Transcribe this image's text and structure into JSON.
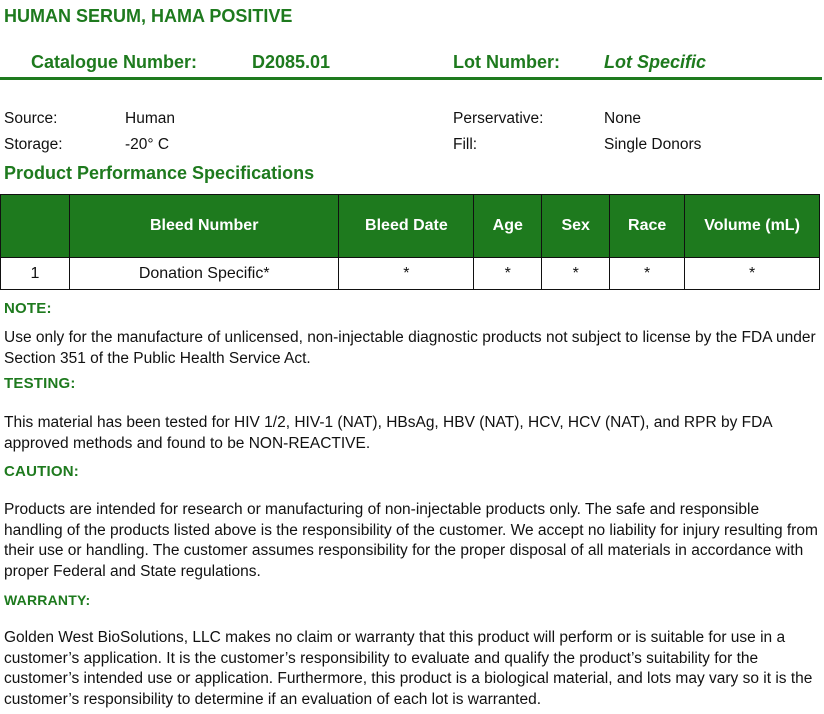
{
  "title": "HUMAN SERUM, HAMA POSITIVE",
  "catalogue": {
    "label": "Catalogue Number:",
    "value": "D2085.01",
    "lot_label": "Lot Number:",
    "lot_value": "Lot Specific"
  },
  "info": {
    "source_label": "Source:",
    "source_value": "Human",
    "storage_label": "Storage:",
    "storage_value": "-20° C",
    "preservative_label": "Perservative:",
    "preservative_value": "None",
    "fill_label": "Fill:",
    "fill_value": "Single Donors"
  },
  "specs": {
    "title": "Product Performance Specifications",
    "columns": [
      "",
      "Bleed Number",
      "Bleed Date",
      "Age",
      "Sex",
      "Race",
      "Volume (mL)"
    ],
    "rows": [
      [
        "1",
        "Donation Specific*",
        "*",
        "*",
        "*",
        "*",
        "*"
      ]
    ]
  },
  "note": {
    "heading": "NOTE:",
    "text": "Use only for the manufacture of unlicensed, non-injectable diagnostic products not subject to license by the FDA under Section 351 of the Public Health Service Act."
  },
  "testing": {
    "heading": "TESTING:",
    "text": "This material has been tested for HIV 1/2, HIV-1 (NAT), HBsAg, HBV (NAT), HCV, HCV (NAT), and RPR by FDA approved methods and found to be NON-REACTIVE."
  },
  "caution": {
    "heading": "CAUTION:",
    "text": "Products are intended for research or manufacturing of non-injectable products only. The safe and responsible handling of the products listed above is the responsibility of the customer. We accept no liability for injury resulting from their use or handling. The customer assumes responsibility for the proper disposal of all materials in accordance with proper Federal and State regulations."
  },
  "warranty": {
    "heading": "WARRANTY:",
    "text": "Golden West BioSolutions, LLC makes no claim or warranty that this product will perform or is suitable for use in a customer’s application. It is the customer’s responsibility to evaluate and qualify the product’s suitability for the customer’s intended use or application. Furthermore, this product is a biological material, and lots may vary so it is the customer’s responsibility to determine if an evaluation of each lot is warranted."
  },
  "colors": {
    "brand_green": "#1e7a1e",
    "header_text": "#ffffff",
    "body_text": "#111111"
  }
}
